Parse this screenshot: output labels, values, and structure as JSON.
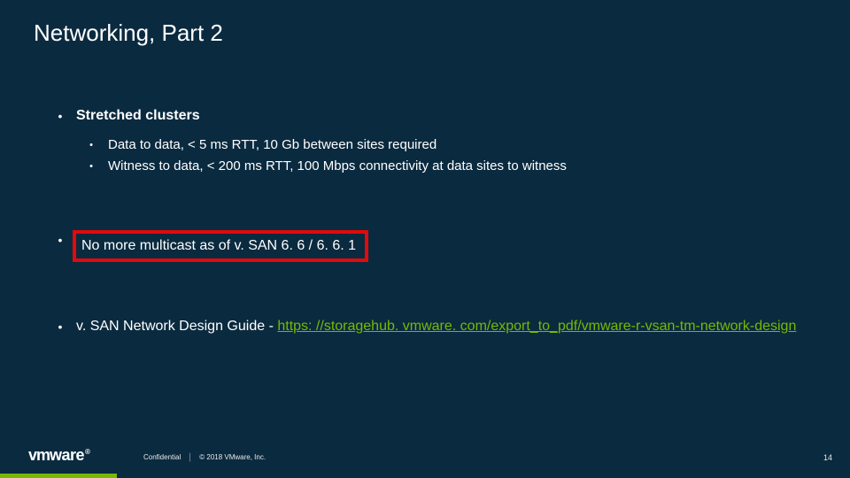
{
  "title": "Networking, Part 2",
  "bullets": {
    "stretched": {
      "heading": "Stretched clusters",
      "sub1": "Data to data, < 5 ms RTT, 10 Gb between sites required",
      "sub2": "Witness to data, < 200 ms RTT, 100 Mbps connectivity at data sites to witness"
    },
    "multicast": "No more multicast as of v. SAN 6. 6 / 6. 6. 1",
    "guide": {
      "prefix": "v. SAN Network Design Guide - ",
      "link": "https: //storagehub. vmware. com/export_to_pdf/vmware-r-vsan-tm-network-design"
    }
  },
  "footer": {
    "logo": "vmware",
    "confidential": "Confidential",
    "copyright": "© 2018 VMware, Inc.",
    "page": "14"
  }
}
